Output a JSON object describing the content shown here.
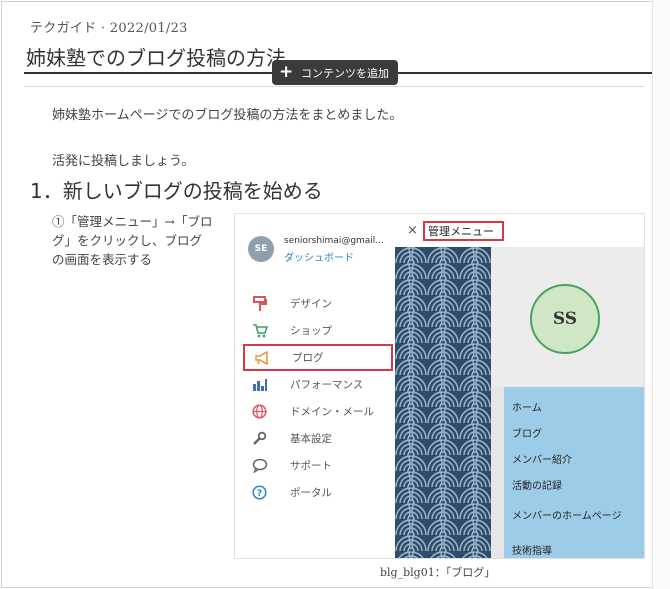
{
  "post": {
    "meta": "テクガイド · 2022/01/23",
    "title": "姉妹塾でのブログ投稿の方法",
    "add_content_label": "コンテンツを追加",
    "intro": "姉妹塾ホームページでのブログ投稿の方法をまとめました。",
    "encourage": "活発に投稿しましょう。",
    "section_heading": "1．新しいブログの投稿を始める",
    "step1_text": "①「管理メニュー」→「ブログ」をクリックし、ブログの画面を表示する",
    "caption": "blg_blg01：「ブログ」"
  },
  "screenshot": {
    "avatar_initials": "SE",
    "user_email": "seniorshimai@gmail...",
    "dashboard_link": "ダッシュボード",
    "menu_items": [
      {
        "label": "デザイン",
        "icon": "paint-roller-icon"
      },
      {
        "label": "ショップ",
        "icon": "cart-icon"
      },
      {
        "label": "ブログ",
        "icon": "megaphone-icon"
      },
      {
        "label": "パフォーマンス",
        "icon": "bar-chart-icon"
      },
      {
        "label": "ドメイン・メール",
        "icon": "globe-icon"
      },
      {
        "label": "基本設定",
        "icon": "wrench-icon"
      },
      {
        "label": "サポート",
        "icon": "chat-icon"
      },
      {
        "label": "ポータル",
        "icon": "help-icon"
      }
    ],
    "close_symbol": "×",
    "admin_menu_label": "管理メニュー",
    "logo_text": "SS",
    "site_nav": [
      "ホーム",
      "ブログ",
      "メンバー紹介",
      "活動の記録",
      "メンバーのホームページ",
      "技術指導"
    ]
  },
  "colors": {
    "highlight": "#d63848",
    "link": "#2a86c9",
    "nav_bg": "#9dcce8",
    "pattern_dark": "#2e4d6b",
    "pattern_light": "#9fb8cf"
  }
}
